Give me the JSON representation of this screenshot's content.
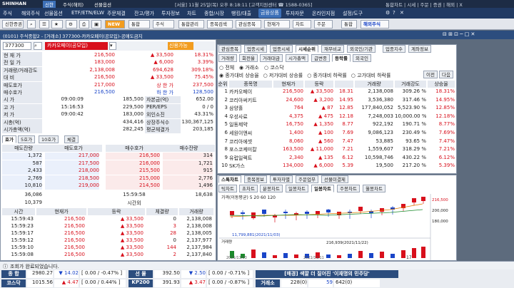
{
  "topbar": {
    "logo": "SHINHAN",
    "mode": "신한",
    "tabs": [
      "주식(해외)",
      "선물옵션"
    ],
    "info": "[서울] 11월 25일(목) 오후 8:18:11 [고객지원센터 ☎ 1588-0365]",
    "right": "통합차트 | 시세 | 주문 | 증권 | 해외 | X"
  },
  "menu": [
    "주식",
    "해외주식",
    "선물옵션",
    "ETF/ETN/ELW",
    "주문체결",
    "잔고/평가",
    "투자정보",
    "차트",
    "종합/시장",
    "뱅킹/대출",
    "금융상품",
    "투자자문",
    "온라인지점",
    "설정/도구"
  ],
  "toolbar": {
    "search": "신한증권",
    "new_badge": "NEW",
    "buttons": [
      "통합관리",
      "종목검색",
      "관심종목",
      "현재가",
      "차트",
      "주문"
    ],
    "sel1": "통합",
    "sel2": "주식",
    "brand": "해외주식"
  },
  "window": {
    "title": "(0101) 주식종합2 - [거래소] 377300-카카오페이(공모입)-공매도금지",
    "code": "377300",
    "name": "카카오페이(공모입)",
    "badge": "신용가능"
  },
  "quote": [
    {
      "label": "현 재 가",
      "v1": "216,500",
      "v2": "▲ 33,500",
      "v3": "18.31%",
      "color": "red"
    },
    {
      "label": "전 일 가",
      "v1": "183,000",
      "v2": "▲ 6,000",
      "v3": "3.39%",
      "color": "red"
    },
    {
      "label": "거래량/거래강도",
      "v1": "2,138,008",
      "v2": "694,628",
      "v3": "309.18%",
      "color": "red"
    },
    {
      "label": "대 비",
      "v1": "216,500",
      "v2": "▲ 33,500",
      "v3": "75.45%",
      "color": "red"
    },
    {
      "label": "매도호가",
      "v1": "217,000",
      "v2": "상 한 가",
      "v3": "237,500",
      "color": "red"
    },
    {
      "label": "매수호가",
      "v1": "216,500",
      "v2": "하 한 가",
      "v3": "128,500",
      "color": "blue"
    },
    {
      "label": "시 가",
      "v1": "09:00:09",
      "v2": "185,500",
      "v3": "자본금(억)",
      "v4": "652.00"
    },
    {
      "label": "고 가",
      "v1": "15:16:53",
      "v2": "229,500",
      "v3": "PER/EPS",
      "v4": "0 / 0"
    },
    {
      "label": "저 가",
      "v1": "09:00:42",
      "v2": "183,000",
      "v3": "외인소진",
      "v4": "43.31%"
    },
    {
      "label": "시총(억)",
      "v1": "",
      "v2": "434,416",
      "v3": "상장주식수",
      "v4": "130,367,125"
    },
    {
      "label": "시가총액(억)",
      "v1": "",
      "v2": "282,245",
      "v3": "평균체결가",
      "v4": "203,185"
    }
  ],
  "orderbook_tabs": [
    "호가",
    "5호가",
    "10호가",
    "체결"
  ],
  "orderbook_header": [
    "매도잔량",
    "매도호가",
    "매수호가",
    "매수잔량"
  ],
  "orderbook": [
    {
      "ask_qty": "1,372",
      "ask": "217,000",
      "bid": "216,500",
      "bid_qty": "314"
    },
    {
      "ask_qty": "587",
      "ask": "217,500",
      "bid": "216,000",
      "bid_qty": "1,721"
    },
    {
      "ask_qty": "2,433",
      "ask": "218,000",
      "bid": "215,500",
      "bid_qty": "915"
    },
    {
      "ask_qty": "2,769",
      "ask": "218,500",
      "bid": "215,000",
      "bid_qty": "2,776"
    },
    {
      "ask_qty": "10,810",
      "ask": "219,000",
      "bid": "214,500",
      "bid_qty": "1,496"
    }
  ],
  "orderbook_total": {
    "ask": "36,086",
    "time": "15:59:58",
    "bid": "18,638"
  },
  "orderbook_after": {
    "ask": "10,379",
    "label": "시간외",
    "bid": ""
  },
  "trades_header": [
    "시간",
    "현재가",
    "등락",
    "체결량",
    "거래량"
  ],
  "trades": [
    {
      "time": "15:59:43",
      "price": "216,500",
      "chg": "▲ 33,500",
      "qty": "0",
      "vol": "2,138,008"
    },
    {
      "time": "15:59:23",
      "price": "216,500",
      "chg": "▲ 33,500",
      "qty": "3",
      "vol": "2,138,008"
    },
    {
      "time": "15:59:17",
      "price": "216,500",
      "chg": "▲ 33,500",
      "qty": "28",
      "vol": "2,138,005"
    },
    {
      "time": "15:59:12",
      "price": "216,500",
      "chg": "▲ 33,500",
      "qty": "0",
      "vol": "2,137,977"
    },
    {
      "time": "15:59:10",
      "price": "216,500",
      "chg": "▲ 33,500",
      "qty": "144",
      "vol": "2,137,984"
    },
    {
      "time": "15:59:08",
      "price": "216,500",
      "chg": "▲ 33,500",
      "qty": "2",
      "vol": "2,137,840"
    }
  ],
  "right_tabs1": [
    "관심종목",
    "업종시세",
    "업종시세",
    "시세순위",
    "재무비교",
    "외국인/기관",
    "업종지수",
    "계좌정보"
  ],
  "right_tabs2": [
    "거래량",
    "회전율",
    "거래대금",
    "시가총액",
    "급변종",
    "등락률",
    "외국인"
  ],
  "filters": {
    "market": [
      "전체",
      "거래소",
      "코스닥"
    ],
    "range": [
      "종가대비 상승율",
      "저가대비 상승률",
      "종가대비 하락률",
      "고가대비 하락률"
    ],
    "prev": "이전",
    "next": "다음"
  },
  "rank_header": [
    "순위",
    "종목명",
    "현재가",
    "등락",
    "",
    "거래량",
    "거래강도",
    "상승율"
  ],
  "ranks": [
    {
      "n": "1",
      "name": "카카오페이",
      "price": "216,500",
      "chg": "▲ 33,500",
      "pct": "18.31",
      "vol": "2,138,008",
      "str": "309.26 %",
      "rate": "18.31%"
    },
    {
      "n": "2",
      "name": "코리아써키트",
      "price": "24,600",
      "chg": "▲ 3,200",
      "pct": "14.95",
      "vol": "3,536,380",
      "str": "317.46 %",
      "rate": "14.95%"
    },
    {
      "n": "3",
      "name": "삼양홀",
      "price": "764",
      "chg": "▲ 87",
      "pct": "12.85",
      "vol": "177,840,052",
      "str": "5,523.90 %",
      "rate": "12.85%"
    },
    {
      "n": "4",
      "name": "우성사료",
      "price": "4,375",
      "chg": "▲ 475",
      "pct": "12.18",
      "vol": "7,248,003",
      "str": "10,000.00 %",
      "rate": "12.18%"
    },
    {
      "n": "5",
      "name": "일동제약",
      "price": "16,750",
      "chg": "▲ 1,350",
      "pct": "8.77",
      "vol": "922,192",
      "str": "190.71 %",
      "rate": "8.77%"
    },
    {
      "n": "6",
      "name": "세원이앤씨",
      "price": "1,400",
      "chg": "▲ 100",
      "pct": "7.69",
      "vol": "9,086,123",
      "str": "230.49 %",
      "rate": "7.69%"
    },
    {
      "n": "7",
      "name": "코리아에셋",
      "price": "8,060",
      "chg": "▲ 560",
      "pct": "7.47",
      "vol": "53,885",
      "str": "93.65 %",
      "rate": "7.47%"
    },
    {
      "n": "8",
      "name": "포스코케미칼",
      "price": "163,500",
      "chg": "▲ 11,000",
      "pct": "7.21",
      "vol": "1,559,607",
      "str": "318.29 %",
      "rate": "7.21%"
    },
    {
      "n": "9",
      "name": "유럽일렉트",
      "price": "2,340",
      "chg": "▲ 135",
      "pct": "6.12",
      "vol": "10,598,746",
      "str": "430.22 %",
      "rate": "6.12%"
    },
    {
      "n": "10",
      "name": "SK가스",
      "price": "134,000",
      "chg": "▲ 6,000",
      "pct": "5.39",
      "vol": "19,500",
      "str": "217.20 %",
      "rate": "5.39%"
    }
  ],
  "chart_tabs1": [
    "스톡차트",
    "종목정보",
    "투자자별",
    "주문업무",
    "선물미결제"
  ],
  "chart_tabs2": [
    "틱차트",
    "초차트",
    "분봉차트",
    "일봉차트",
    "일봉차트",
    "주봉차트",
    "월봉차트"
  ],
  "chart": {
    "legend": "가격(이동평균) 5 20 60 120",
    "volume_label": "거래량",
    "price_labels": [
      "216,500",
      "200,000",
      "180,000"
    ],
    "low_marker": "11,799,881(2021/11/03)",
    "note": "216,939(2021/11/22)",
    "date1": "2021/11/03",
    "date2": "2021/11/11",
    "zoom": "17"
  },
  "status": {
    "msg": "조회가 완료되었습니다."
  },
  "index_rows": [
    [
      {
        "label": "종 합",
        "v1": "2980.27",
        "v2": "▼ 14.02",
        "v3": "[ 0.00 / -0.47% ]"
      },
      {
        "label": "선 물",
        "v1": "392.50",
        "v2": "▼ 2.50",
        "v3": "[ 0.00 / -0.71% ]"
      },
      {
        "label": "[매경] 색깔 더 짙어진 '이재명의 민주당'",
        "v1": "",
        "v2": "",
        "v3": ""
      }
    ],
    [
      {
        "label": "코스닥",
        "v1": "1015.56",
        "v2": "▲ 4.47",
        "v3": "[ 0.00 / 0.44% ]"
      },
      {
        "label": "KP200",
        "v1": "391.93",
        "v2": "▲ 3.47",
        "v3": "[ 0.00 / -0.87% ]"
      },
      {
        "label": "거래소",
        "v1": "228(0)",
        "v2": "59",
        "v3": "642(0)"
      }
    ]
  ],
  "colors": {
    "up": "#d8101c",
    "down": "#1a45c8",
    "title": "#2c4d7e",
    "menu": "#213a63"
  }
}
